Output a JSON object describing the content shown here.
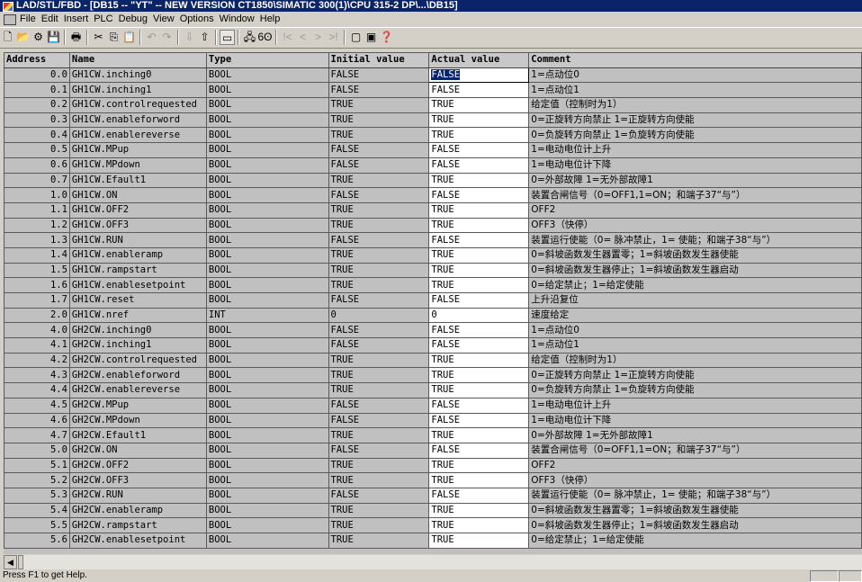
{
  "window": {
    "title": "LAD/STL/FBD  - [DB15 -- \"YT\" -- NEW VERSION CT1850\\SIMATIC 300(1)\\CPU 315-2 DP\\...\\DB15]"
  },
  "menu": [
    "File",
    "Edit",
    "Insert",
    "PLC",
    "Debug",
    "View",
    "Options",
    "Window",
    "Help"
  ],
  "toolbar": [
    {
      "icon": "new-icon",
      "glyph": "🗋",
      "state": "normal"
    },
    {
      "icon": "open-icon",
      "glyph": "📂",
      "state": "normal"
    },
    {
      "icon": "accessible-nodes-icon",
      "glyph": "⚙",
      "state": "normal"
    },
    {
      "icon": "save-icon",
      "glyph": "💾",
      "state": "normal"
    },
    {
      "sep": true
    },
    {
      "icon": "print-icon",
      "glyph": "🖶",
      "state": "normal"
    },
    {
      "sep": true
    },
    {
      "icon": "cut-icon",
      "glyph": "✂",
      "state": "normal"
    },
    {
      "icon": "copy-icon",
      "glyph": "⎘",
      "state": "normal"
    },
    {
      "icon": "paste-icon",
      "glyph": "📋",
      "state": "disabled"
    },
    {
      "sep": true
    },
    {
      "icon": "undo-icon",
      "glyph": "↶",
      "state": "disabled"
    },
    {
      "icon": "redo-icon",
      "glyph": "↷",
      "state": "disabled"
    },
    {
      "sep": true
    },
    {
      "icon": "download-icon",
      "glyph": "⇩",
      "state": "disabled"
    },
    {
      "icon": "upload-icon",
      "glyph": "⇧",
      "state": "normal"
    },
    {
      "sep": true
    },
    {
      "icon": "monitor-icon",
      "glyph": "▭",
      "state": "active"
    },
    {
      "sep": true
    },
    {
      "icon": "network-icon",
      "glyph": "🖧",
      "state": "normal"
    },
    {
      "icon": "monitor-glasses-icon",
      "glyph": "6ʘ",
      "state": "normal"
    },
    {
      "sep": true
    },
    {
      "icon": "first-icon",
      "glyph": "!<",
      "state": "disabled"
    },
    {
      "icon": "prev-icon",
      "glyph": "<",
      "state": "disabled"
    },
    {
      "icon": "next-icon",
      "glyph": ">",
      "state": "disabled"
    },
    {
      "icon": "last-icon",
      "glyph": ">!",
      "state": "disabled"
    },
    {
      "sep": true
    },
    {
      "icon": "overview-icon",
      "glyph": "▢",
      "state": "normal"
    },
    {
      "icon": "details-icon",
      "glyph": "▣",
      "state": "normal"
    },
    {
      "icon": "help-pointer-icon",
      "glyph": "❓",
      "state": "normal"
    }
  ],
  "table": {
    "headers": {
      "address": "Address",
      "name": "Name",
      "type": "Type",
      "initial": "Initial value",
      "actual": "Actual value",
      "comment": "Comment"
    },
    "rows": [
      {
        "address": "0.0",
        "name": "GH1CW.inching0",
        "type": "BOOL",
        "initial": "FALSE",
        "actual": "FALSE",
        "comment": "1=点动位0"
      },
      {
        "address": "0.1",
        "name": "GH1CW.inching1",
        "type": "BOOL",
        "initial": "FALSE",
        "actual": "FALSE",
        "comment": "1=点动位1"
      },
      {
        "address": "0.2",
        "name": "GH1CW.controlrequested",
        "type": "BOOL",
        "initial": "TRUE",
        "actual": "TRUE",
        "comment": "给定值（控制时为1）"
      },
      {
        "address": "0.3",
        "name": "GH1CW.enableforword",
        "type": "BOOL",
        "initial": "TRUE",
        "actual": "TRUE",
        "comment": "0=正旋转方向禁止 1=正旋转方向使能"
      },
      {
        "address": "0.4",
        "name": "GH1CW.enablereverse",
        "type": "BOOL",
        "initial": "TRUE",
        "actual": "TRUE",
        "comment": "0=负旋转方向禁止 1=负旋转方向使能"
      },
      {
        "address": "0.5",
        "name": "GH1CW.MPup",
        "type": "BOOL",
        "initial": "FALSE",
        "actual": "FALSE",
        "comment": "1=电动电位计上升"
      },
      {
        "address": "0.6",
        "name": "GH1CW.MPdown",
        "type": "BOOL",
        "initial": "FALSE",
        "actual": "FALSE",
        "comment": "1=电动电位计下降"
      },
      {
        "address": "0.7",
        "name": "GH1CW.Efault1",
        "type": "BOOL",
        "initial": "TRUE",
        "actual": "TRUE",
        "comment": "0=外部故障 1=无外部故障1"
      },
      {
        "address": "1.0",
        "name": "GH1CW.ON",
        "type": "BOOL",
        "initial": "FALSE",
        "actual": "FALSE",
        "comment": "装置合闸信号（0=OFF1,1=ON；和端子37“与”）"
      },
      {
        "address": "1.1",
        "name": "GH1CW.OFF2",
        "type": "BOOL",
        "initial": "TRUE",
        "actual": "TRUE",
        "comment": "OFF2"
      },
      {
        "address": "1.2",
        "name": "GH1CW.OFF3",
        "type": "BOOL",
        "initial": "TRUE",
        "actual": "TRUE",
        "comment": "OFF3（快停）"
      },
      {
        "address": "1.3",
        "name": "GH1CW.RUN",
        "type": "BOOL",
        "initial": "FALSE",
        "actual": "FALSE",
        "comment": "装置运行使能（0= 脉冲禁止，1= 使能；和端子38“与”）"
      },
      {
        "address": "1.4",
        "name": "GH1CW.enableramp",
        "type": "BOOL",
        "initial": "TRUE",
        "actual": "TRUE",
        "comment": "0=斜坡函数发生器置零；1=斜坡函数发生器使能"
      },
      {
        "address": "1.5",
        "name": "GH1CW.rampstart",
        "type": "BOOL",
        "initial": "TRUE",
        "actual": "TRUE",
        "comment": "0=斜坡函数发生器停止；1=斜坡函数发生器启动"
      },
      {
        "address": "1.6",
        "name": "GH1CW.enablesetpoint",
        "type": "BOOL",
        "initial": "TRUE",
        "actual": "TRUE",
        "comment": "0=给定禁止；1=给定使能"
      },
      {
        "address": "1.7",
        "name": "GH1CW.reset",
        "type": "BOOL",
        "initial": "FALSE",
        "actual": "FALSE",
        "comment": "上升沿复位"
      },
      {
        "address": "2.0",
        "name": "GH1CW.nref",
        "type": "INT",
        "initial": "0",
        "actual": "0",
        "comment": "速度给定"
      },
      {
        "address": "4.0",
        "name": "GH2CW.inching0",
        "type": "BOOL",
        "initial": "FALSE",
        "actual": "FALSE",
        "comment": "1=点动位0"
      },
      {
        "address": "4.1",
        "name": "GH2CW.inching1",
        "type": "BOOL",
        "initial": "FALSE",
        "actual": "FALSE",
        "comment": "1=点动位1"
      },
      {
        "address": "4.2",
        "name": "GH2CW.controlrequested",
        "type": "BOOL",
        "initial": "TRUE",
        "actual": "TRUE",
        "comment": "给定值（控制时为1）"
      },
      {
        "address": "4.3",
        "name": "GH2CW.enableforword",
        "type": "BOOL",
        "initial": "TRUE",
        "actual": "TRUE",
        "comment": "0=正旋转方向禁止 1=正旋转方向使能"
      },
      {
        "address": "4.4",
        "name": "GH2CW.enablereverse",
        "type": "BOOL",
        "initial": "TRUE",
        "actual": "TRUE",
        "comment": "0=负旋转方向禁止 1=负旋转方向使能"
      },
      {
        "address": "4.5",
        "name": "GH2CW.MPup",
        "type": "BOOL",
        "initial": "FALSE",
        "actual": "FALSE",
        "comment": "1=电动电位计上升"
      },
      {
        "address": "4.6",
        "name": "GH2CW.MPdown",
        "type": "BOOL",
        "initial": "FALSE",
        "actual": "FALSE",
        "comment": "1=电动电位计下降"
      },
      {
        "address": "4.7",
        "name": "GH2CW.Efault1",
        "type": "BOOL",
        "initial": "TRUE",
        "actual": "TRUE",
        "comment": "0=外部故障 1=无外部故障1"
      },
      {
        "address": "5.0",
        "name": "GH2CW.ON",
        "type": "BOOL",
        "initial": "FALSE",
        "actual": "FALSE",
        "comment": "装置合闸信号（0=OFF1,1=ON；和端子37“与”）"
      },
      {
        "address": "5.1",
        "name": "GH2CW.OFF2",
        "type": "BOOL",
        "initial": "TRUE",
        "actual": "TRUE",
        "comment": "OFF2"
      },
      {
        "address": "5.2",
        "name": "GH2CW.OFF3",
        "type": "BOOL",
        "initial": "TRUE",
        "actual": "TRUE",
        "comment": "OFF3（快停）"
      },
      {
        "address": "5.3",
        "name": "GH2CW.RUN",
        "type": "BOOL",
        "initial": "FALSE",
        "actual": "FALSE",
        "comment": "装置运行使能（0= 脉冲禁止，1= 使能；和端子38“与”）"
      },
      {
        "address": "5.4",
        "name": "GH2CW.enableramp",
        "type": "BOOL",
        "initial": "TRUE",
        "actual": "TRUE",
        "comment": "0=斜坡函数发生器置零；1=斜坡函数发生器使能"
      },
      {
        "address": "5.5",
        "name": "GH2CW.rampstart",
        "type": "BOOL",
        "initial": "TRUE",
        "actual": "TRUE",
        "comment": "0=斜坡函数发生器停止；1=斜坡函数发生器启动"
      },
      {
        "address": "5.6",
        "name": "GH2CW.enablesetpoint",
        "type": "BOOL",
        "initial": "TRUE",
        "actual": "TRUE",
        "comment": "0=给定禁止；1=给定使能"
      }
    ],
    "selected_row": 0
  },
  "status": {
    "text": "Press F1 to get Help."
  },
  "colors": {
    "title_bar": "#0a246a",
    "selection": "#0a246a",
    "grid_bg": "#c0c0c0",
    "actual_cell_bg": "#ffffff"
  }
}
